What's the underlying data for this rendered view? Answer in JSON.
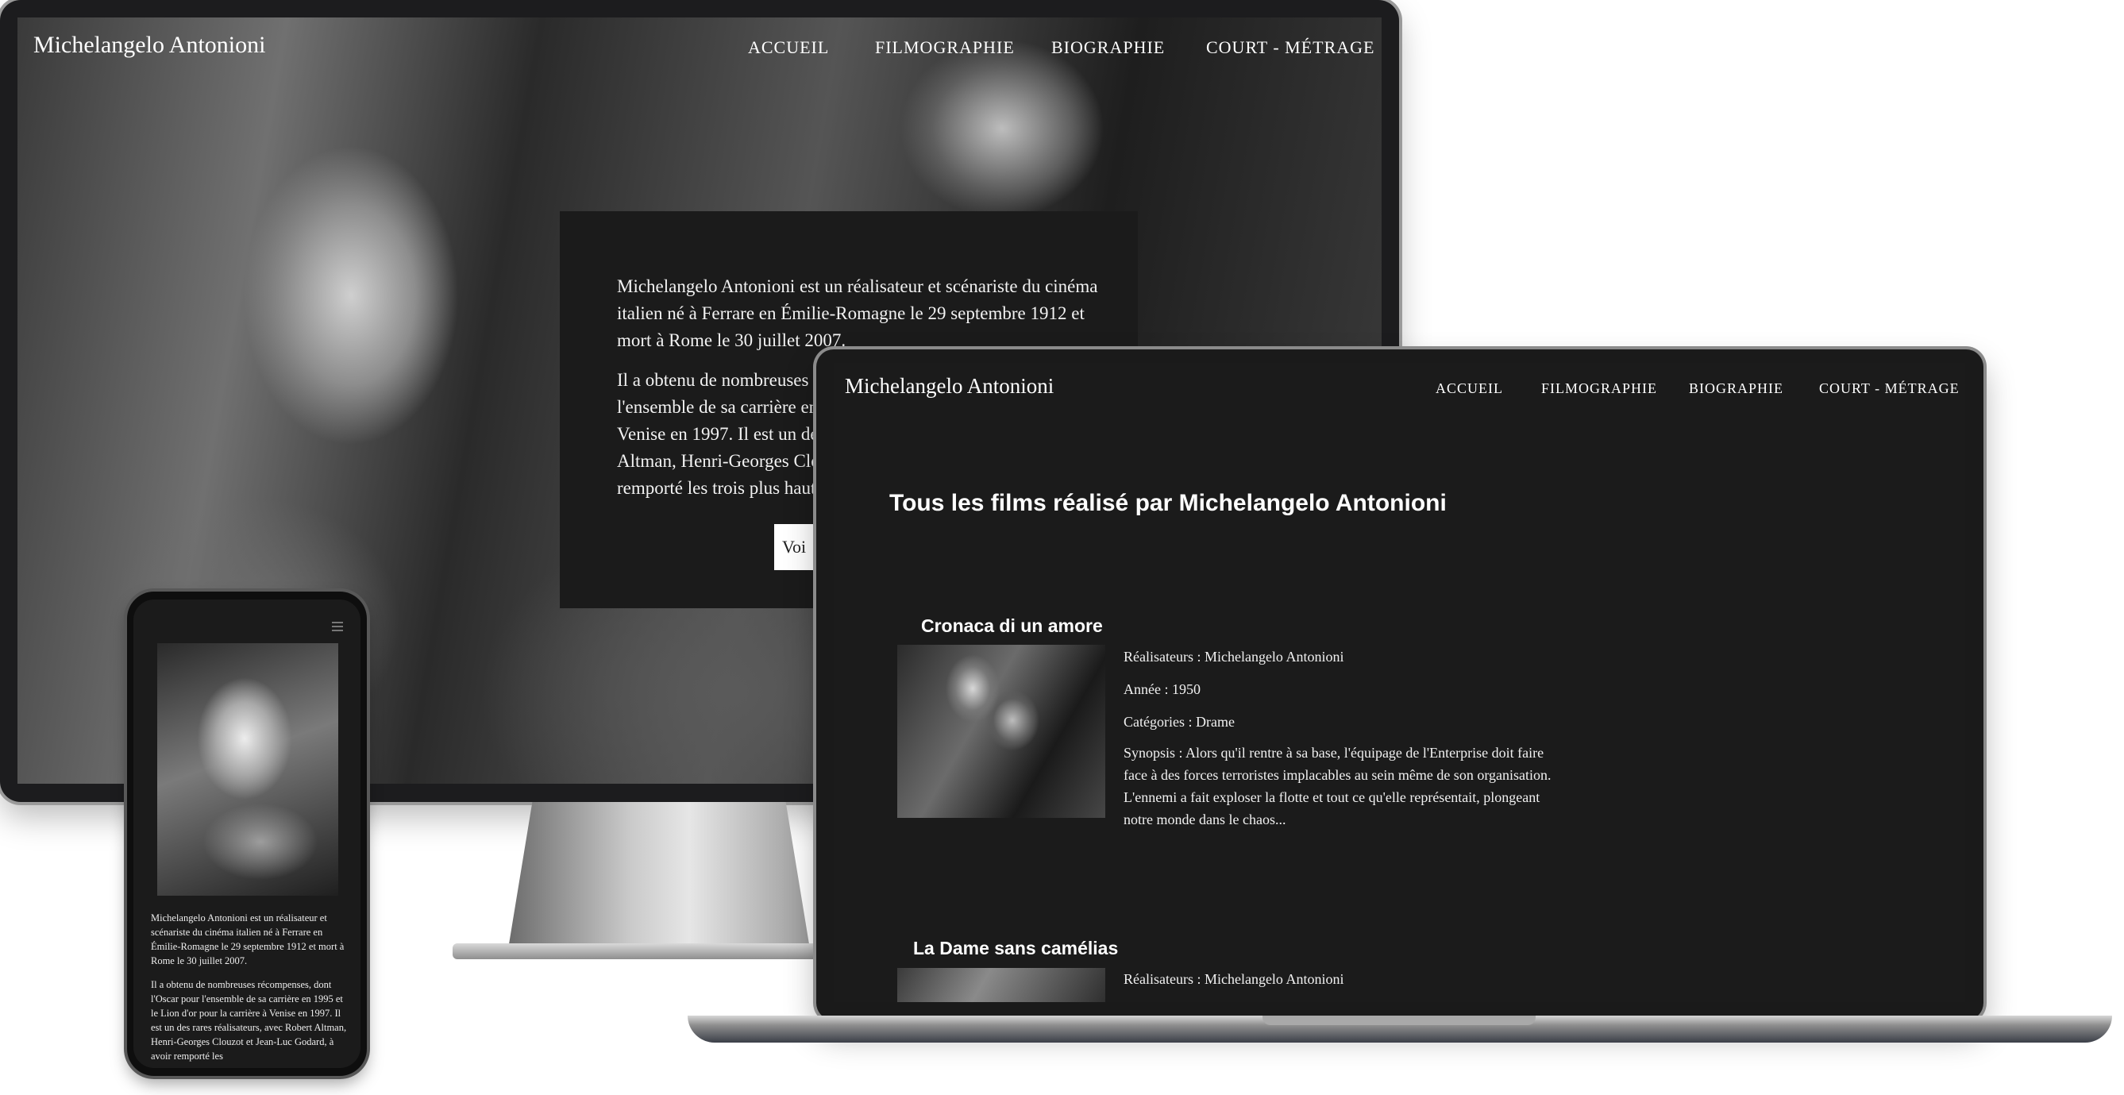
{
  "brand": "Michelangelo Antonioni",
  "nav": [
    "ACCUEIL",
    "FILMOGRAPHIE",
    "BIOGRAPHIE",
    "COURT - MÉTRAGE"
  ],
  "desktop": {
    "paragraph1": "Michelangelo Antonioni est un réalisateur et scénariste du cinéma italien né à Ferrare en Émilie-Romagne le 29 septembre 1912 et mort à Rome le 30 juillet 2007.",
    "paragraph2": "Il a obtenu de nombreuses r l'ensemble de sa carrière en Venise en 1997. Il est un des Altman, Henri-Georges Clo remporté les trois plus haut festivals européens que son",
    "button_label": "Voi"
  },
  "mobile": {
    "paragraph1": "Michelangelo Antonioni est un réalisateur et scénariste du cinéma italien né à Ferrare en Émilie-Romagne le 29 septembre 1912 et mort à Rome le 30 juillet 2007.",
    "paragraph2": "Il a obtenu de nombreuses récompenses, dont l'Oscar pour l'ensemble de sa carrière en 1995 et le Lion d'or pour la carrière à Venise en 1997. Il est un des rares réalisateurs, avec Robert Altman, Henri-Georges Clouzot et Jean-Luc Godard, à avoir remporté les"
  },
  "filmography": {
    "title": "Tous les films réalisé par Michelangelo Antonioni",
    "films": [
      {
        "title": "Cronaca di un amore",
        "director": "Réalisateurs : Michelangelo Antonioni",
        "year": "Année : 1950",
        "category": "Catégories : Drame",
        "synopsis": "Synopsis : Alors qu'il rentre à sa base, l'équipage de l'Enterprise doit faire face à des forces terroristes implacables au sein même de son organisation. L'ennemi a fait exploser la flotte et tout ce qu'elle représentait, plongeant notre monde dans le chaos..."
      },
      {
        "title": "La Dame sans camélias",
        "director": "Réalisateurs : Michelangelo Antonioni"
      }
    ]
  }
}
